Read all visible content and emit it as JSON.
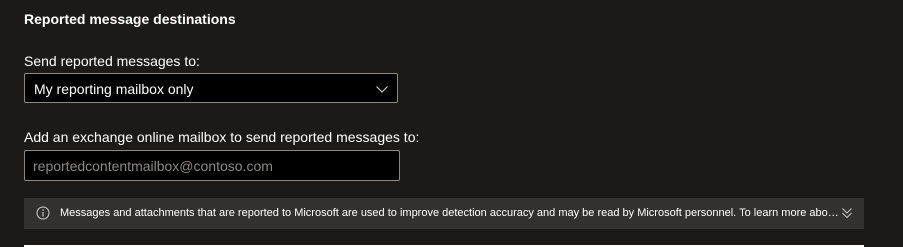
{
  "section": {
    "title": "Reported message destinations"
  },
  "send_to": {
    "label": "Send reported messages to:",
    "selected": "My reporting mailbox only"
  },
  "mailbox": {
    "label": "Add an exchange online mailbox to send reported messages to:",
    "placeholder": "reportedcontentmailbox@contoso.com",
    "value": ""
  },
  "info": {
    "message": "Messages and attachments that are reported to Microsoft are used to improve detection accuracy and may be read by Microsoft personnel. To learn more about how Microsoft handles your data, see the privacy statement."
  },
  "icons": {
    "dropdown": "chevron-down-icon",
    "info": "info-icon",
    "expand": "double-chevron-down-icon"
  },
  "colors": {
    "background": "#1b1a19",
    "field_bg": "#000000",
    "border": "#8a8886",
    "infobar_bg": "#323130",
    "text": "#ffffff",
    "placeholder": "#8a8886"
  }
}
